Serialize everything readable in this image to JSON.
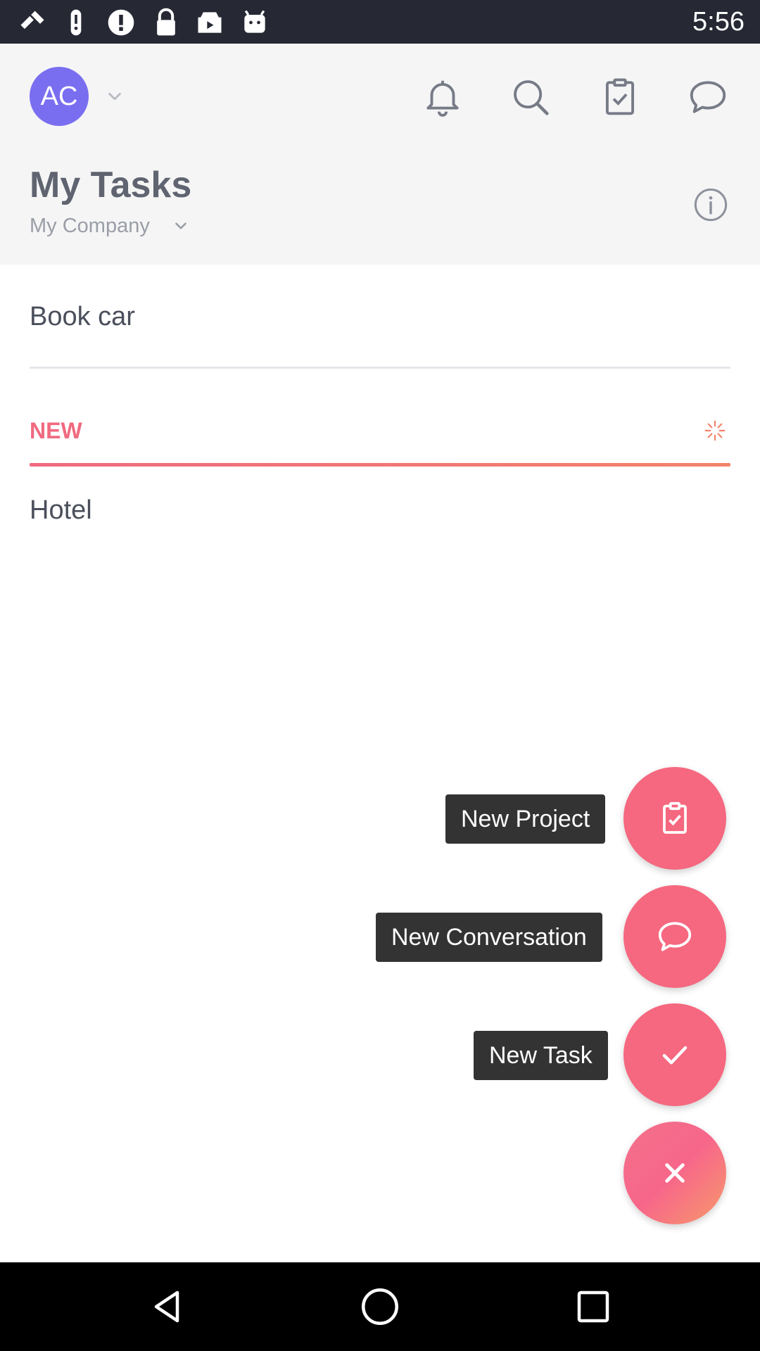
{
  "status_bar": {
    "time": "5:56",
    "icons": [
      "satellite-icon",
      "alert-icon",
      "info-circle-icon",
      "lock-icon",
      "play-store-icon",
      "android-icon"
    ],
    "background": "#262834"
  },
  "header": {
    "avatar_initials": "AC",
    "avatar_color": "#7a6ef0",
    "actions": [
      "bell-icon",
      "search-icon",
      "clipboard-check-icon",
      "chat-bubble-icon"
    ],
    "title": "My Tasks",
    "workspace": "My Company"
  },
  "tasks": {
    "first": "Book car",
    "section_label": "NEW",
    "second": "Hotel"
  },
  "fab_menu": {
    "new_project": "New Project",
    "new_conversation": "New Conversation",
    "new_task": "New Task",
    "accent": "#f5687f"
  },
  "nav_bar": {
    "buttons": [
      "back-icon",
      "home-icon",
      "recents-icon"
    ]
  }
}
